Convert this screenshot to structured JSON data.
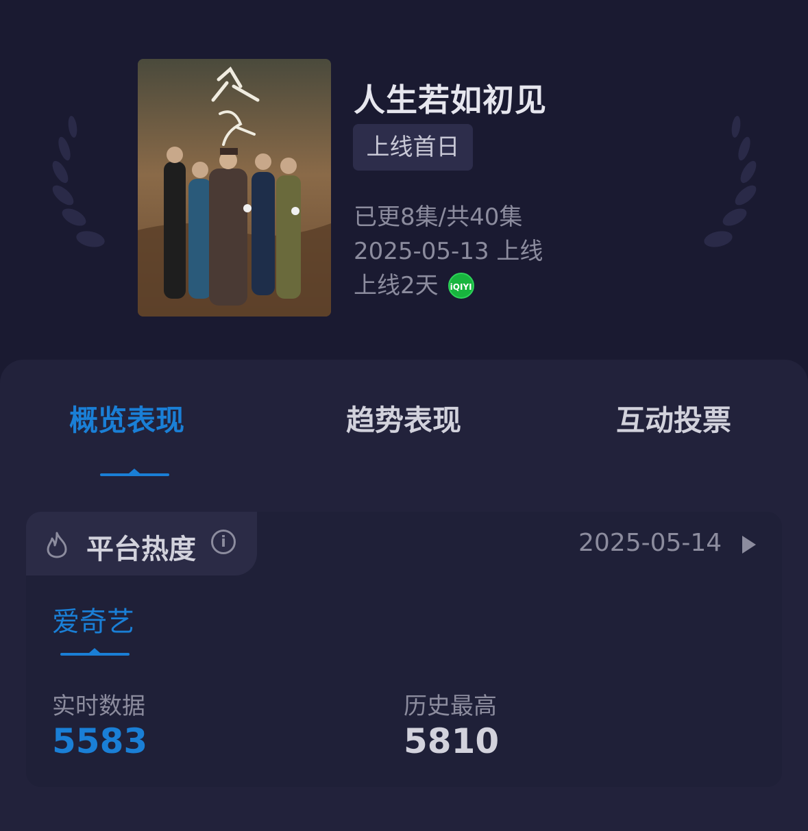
{
  "colors": {
    "background": "#1a1a31",
    "panel": "#22223b",
    "card": "#1f2038",
    "accent": "#1a7fd6",
    "text_primary": "#e6e6ee",
    "text_secondary": "#8c8c9e",
    "iqiyi_green": "#18b53e"
  },
  "show": {
    "title": "人生若如初见",
    "badge": "上线首日",
    "episodes": "已更8集/共40集",
    "release": "2025-05-13 上线",
    "days_online": "上线2天",
    "platform_logo": "iQIYI"
  },
  "tabs": [
    {
      "label": "概览表现",
      "active": true
    },
    {
      "label": "趋势表现",
      "active": false
    },
    {
      "label": "互动投票",
      "active": false
    }
  ],
  "heat_card": {
    "title": "平台热度",
    "date": "2025-05-14",
    "platform": "爱奇艺",
    "realtime_label": "实时数据",
    "realtime_value": "5583",
    "peak_label": "历史最高",
    "peak_value": "5810"
  },
  "icons": {
    "laurel": "laurel-wreath-icon",
    "flame": "flame-icon",
    "info": "info-icon",
    "play": "play-triangle-icon"
  }
}
